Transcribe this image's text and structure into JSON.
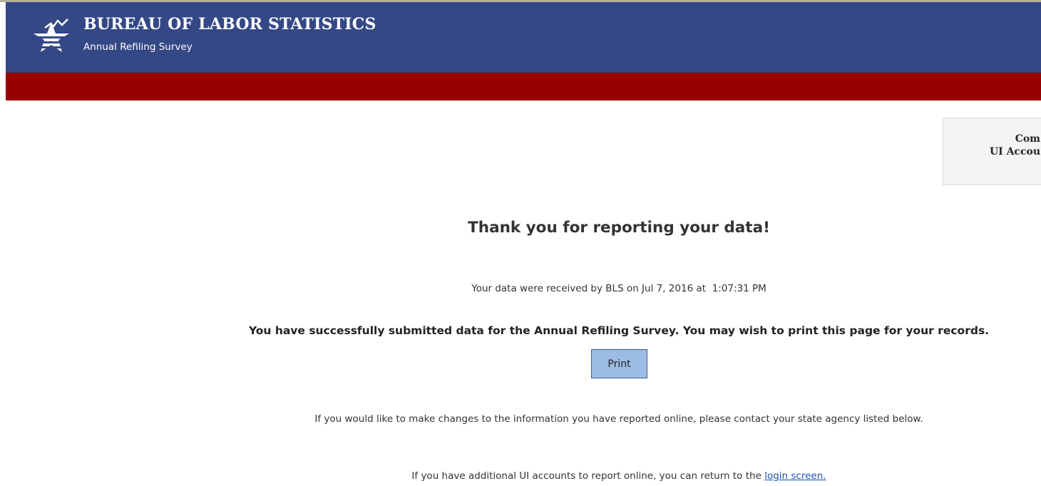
{
  "header": {
    "title": "BUREAU OF LABOR STATISTICS",
    "subtitle": "Annual Refiling Survey",
    "logo_icon": "bls-star-logo-icon",
    "colors": {
      "blue": "#344886",
      "red": "#990000"
    }
  },
  "side_box": {
    "line1": "Com",
    "line2": "UI Accou"
  },
  "main": {
    "heading": "Thank you for reporting your data!",
    "received_prefix": "Your data were received by BLS on",
    "received_date": "Jul 7, 2016",
    "received_at": "at",
    "received_time": "1:07:31 PM",
    "success_message": "You have successfully submitted data for the Annual Refiling Survey. You may wish to print this page for your records.",
    "print_button": "Print",
    "changes_message": "If you would like to make changes to the information you have reported online, please contact your state agency listed below.",
    "additional_prefix": "If you have additional UI accounts to report online, you can return to the",
    "login_link": "login screen."
  }
}
